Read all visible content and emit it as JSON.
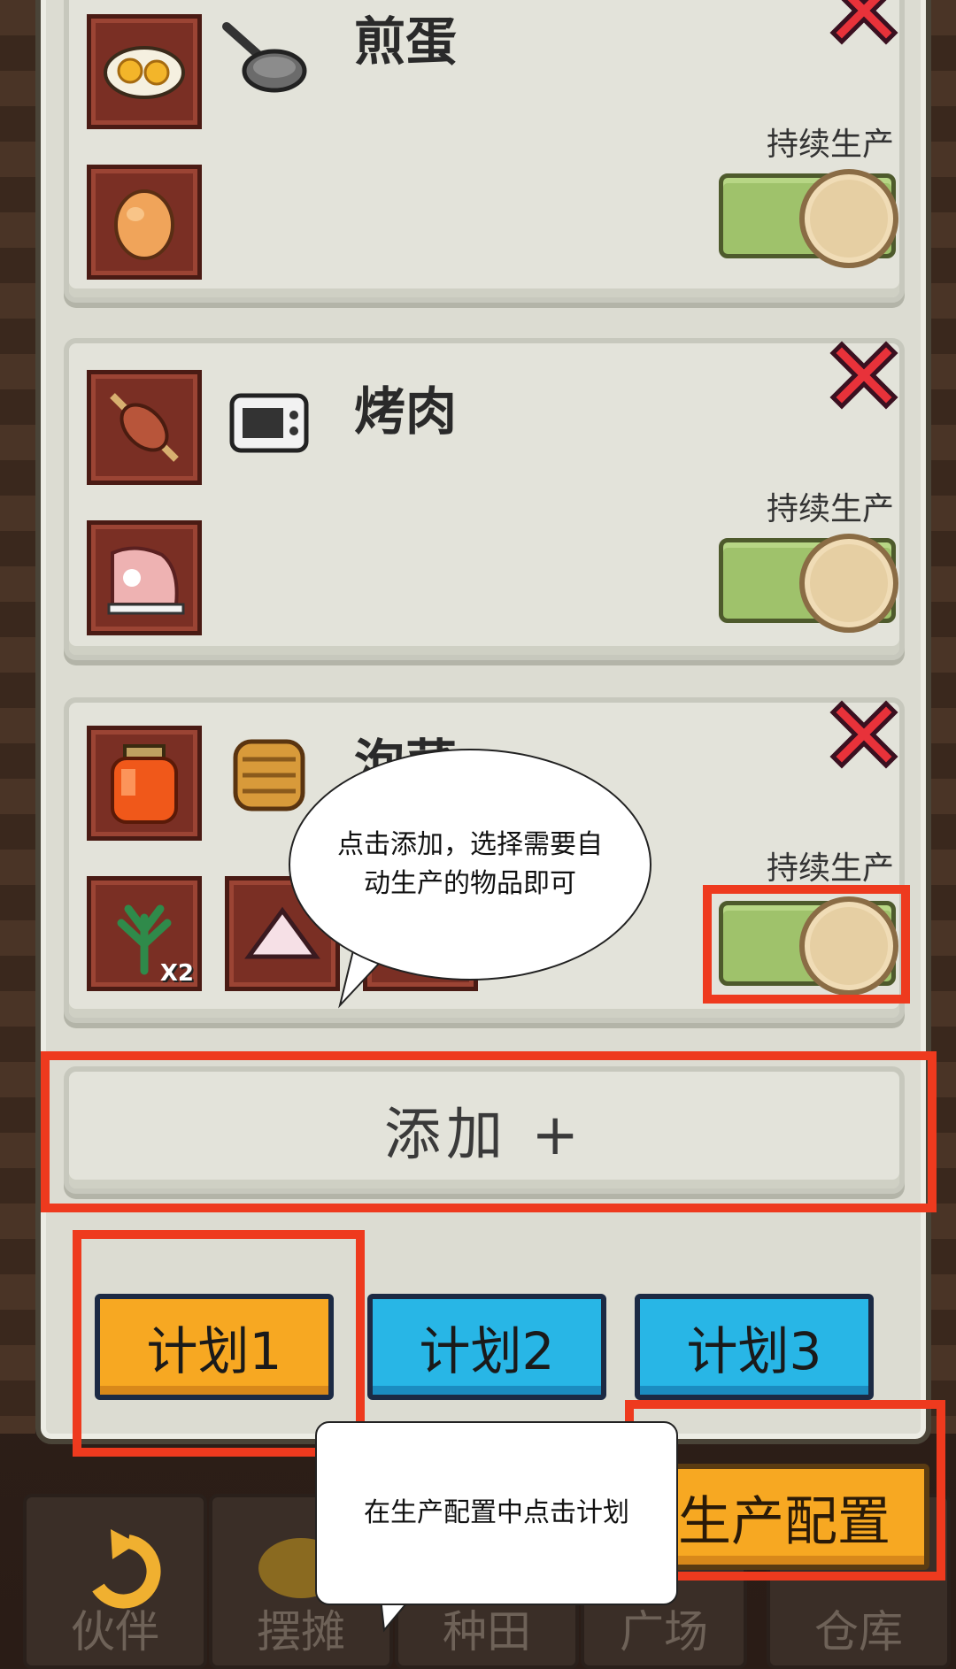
{
  "cards": [
    {
      "title": "煎蛋",
      "toggle_label": "持续生产"
    },
    {
      "title": "烤肉",
      "toggle_label": "持续生产"
    },
    {
      "title": "泡菜",
      "toggle_label": "持续生产",
      "ingredient_qty": "X2"
    }
  ],
  "add_button": "添加 +",
  "plans": [
    "计划1",
    "计划2",
    "计划3"
  ],
  "config_button": "生产配置",
  "bottom_nav": [
    "伙伴",
    "摆摊",
    "种田",
    "广场",
    "仓库"
  ],
  "tips": {
    "add_tip": "点击添加，选择需要自动生产的物品即可",
    "plan_tip": "在生产配置中点击计划"
  },
  "colors": {
    "highlight": "#ee3a1e",
    "plan_active": "#f7a822",
    "plan_inactive": "#28b6e6",
    "toggle_on": "#9fc26b"
  }
}
